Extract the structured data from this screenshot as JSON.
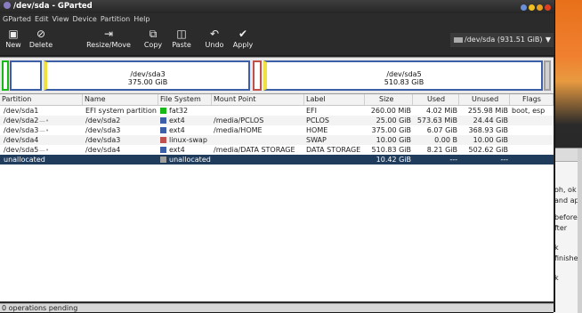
{
  "window": {
    "title": "/dev/sda - GParted"
  },
  "menu": [
    "GParted",
    "Edit",
    "View",
    "Device",
    "Partition",
    "Help"
  ],
  "toolbar": {
    "new": "New",
    "delete": "Delete",
    "resize": "Resize/Move",
    "copy": "Copy",
    "paste": "Paste",
    "undo": "Undo",
    "apply": "Apply"
  },
  "device": {
    "selected": "/dev/sda  (931.51 GiB)"
  },
  "map": {
    "sda3": {
      "name": "/dev/sda3",
      "size": "375.00 GiB"
    },
    "sda5": {
      "name": "/dev/sda5",
      "size": "510.83 GiB"
    }
  },
  "columns": [
    "Partition",
    "Name",
    "File System",
    "Mount Point",
    "Label",
    "Size",
    "Used",
    "Unused",
    "Flags"
  ],
  "partitions": [
    {
      "partition": "/dev/sda1",
      "key": false,
      "name": "EFI system partition",
      "fs": "fat32",
      "fs_color": "#18b818",
      "mount": "",
      "label": "EFI",
      "size": "260.00 MiB",
      "used": "4.02 MiB",
      "unused": "255.98 MiB",
      "flags": "boot, esp"
    },
    {
      "partition": "/dev/sda2",
      "key": true,
      "name": "/dev/sda2",
      "fs": "ext4",
      "fs_color": "#3d5fa8",
      "mount": "/media/PCLOS",
      "label": "PCLOS",
      "size": "25.00 GiB",
      "used": "573.63 MiB",
      "unused": "24.44 GiB",
      "flags": ""
    },
    {
      "partition": "/dev/sda3",
      "key": true,
      "name": "/dev/sda3",
      "fs": "ext4",
      "fs_color": "#3d5fa8",
      "mount": "/media/HOME",
      "label": "HOME",
      "size": "375.00 GiB",
      "used": "6.07 GiB",
      "unused": "368.93 GiB",
      "flags": ""
    },
    {
      "partition": "/dev/sda4",
      "key": false,
      "name": "/dev/sda3",
      "fs": "linux-swap",
      "fs_color": "#c0504d",
      "mount": "",
      "label": "SWAP",
      "size": "10.00 GiB",
      "used": "0.00 B",
      "unused": "10.00 GiB",
      "flags": ""
    },
    {
      "partition": "/dev/sda5",
      "key": true,
      "name": "/dev/sda4",
      "fs": "ext4",
      "fs_color": "#3d5fa8",
      "mount": "/media/DATA STORAGE",
      "label": "DATA STORAGE",
      "size": "510.83 GiB",
      "used": "8.21 GiB",
      "unused": "502.62 GiB",
      "flags": ""
    },
    {
      "partition": "unallocated",
      "key": false,
      "name": "",
      "fs": "unallocated",
      "fs_color": "#a0a0a0",
      "mount": "",
      "label": "",
      "size": "10.42 GiB",
      "used": "---",
      "unused": "---",
      "flags": "",
      "selected": true
    }
  ],
  "status": "0 operations pending",
  "background_text": [
    "oh, ok",
    "and ap",
    "before",
    "fter",
    "k",
    "finishe",
    "k"
  ]
}
